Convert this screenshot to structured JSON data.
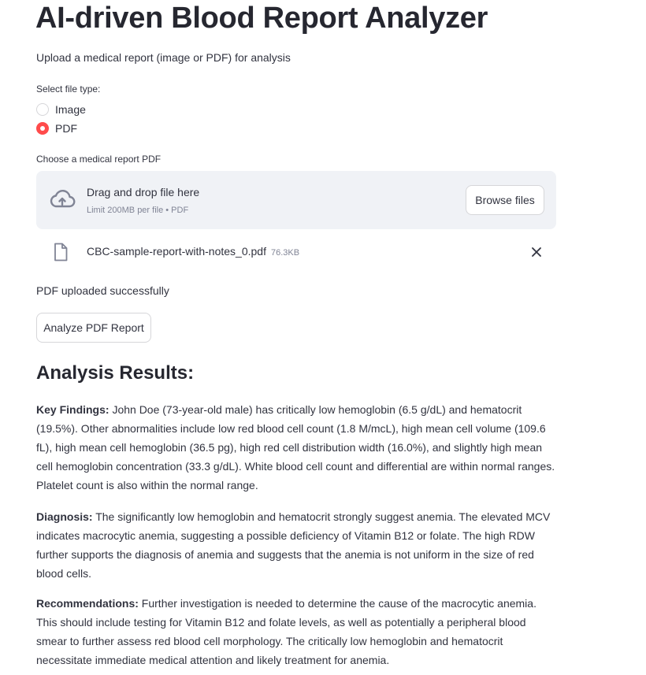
{
  "header": {
    "title": "AI-driven Blood Report Analyzer",
    "subtitle": "Upload a medical report (image or PDF) for analysis"
  },
  "file_type": {
    "label": "Select file type:",
    "options": [
      "Image",
      "PDF"
    ],
    "selected": "PDF"
  },
  "uploader": {
    "label": "Choose a medical report PDF",
    "drag_text": "Drag and drop file here",
    "limit_text": "Limit 200MB per file • PDF",
    "browse_label": "Browse files",
    "icon": "cloud-upload-icon"
  },
  "uploaded_file": {
    "name": "CBC-sample-report-with-notes_0.pdf",
    "size": "76.3KB",
    "icon": "file-icon",
    "remove_icon": "close-icon"
  },
  "status_text": "PDF uploaded successfully",
  "analyze_button": "Analyze PDF Report",
  "results": {
    "title": "Analysis Results:",
    "key_findings_label": "Key Findings:",
    "key_findings_text": " John Doe (73-year-old male) has critically low hemoglobin (6.5 g/dL) and hematocrit (19.5%). Other abnormalities include low red blood cell count (1.8 M/mcL), high mean cell volume (109.6 fL), high mean cell hemoglobin (36.5 pg), high red cell distribution width (16.0%), and slightly high mean cell hemoglobin concentration (33.3 g/dL). White blood cell count and differential are within normal ranges. Platelet count is also within the normal range.",
    "diagnosis_label": "Diagnosis:",
    "diagnosis_text": " The significantly low hemoglobin and hematocrit strongly suggest anemia. The elevated MCV indicates macrocytic anemia, suggesting a possible deficiency of Vitamin B12 or folate. The high RDW further supports the diagnosis of anemia and suggests that the anemia is not uniform in the size of red blood cells.",
    "recommendations_label": "Recommendations:",
    "recommendations_text": " Further investigation is needed to determine the cause of the macrocytic anemia. This should include testing for Vitamin B12 and folate levels, as well as potentially a peripheral blood smear to further assess red blood cell morphology. The critically low hemoglobin and hematocrit necessitate immediate medical attention and likely treatment for anemia."
  },
  "colors": {
    "accent": "#ff4b4b",
    "dropzone_bg": "#f0f2f6",
    "text": "#31333f",
    "muted": "#808495"
  }
}
